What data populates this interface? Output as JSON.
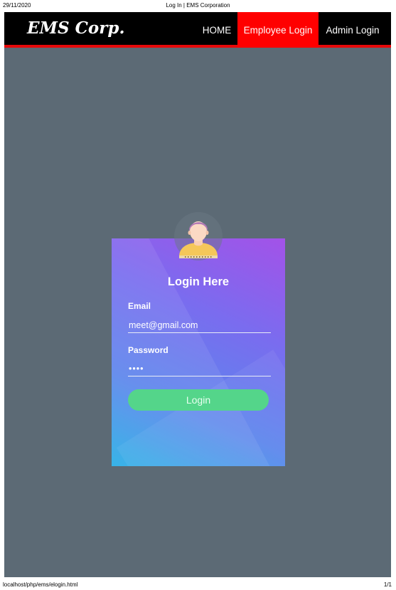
{
  "print_header": {
    "date": "29/11/2020",
    "title": "Log In | EMS Corporation"
  },
  "navbar": {
    "brand": "EMS Corp.",
    "links": [
      {
        "label": "HOME",
        "active": false
      },
      {
        "label": "Employee Login",
        "active": true
      },
      {
        "label": "Admin Login",
        "active": false
      }
    ],
    "colors": {
      "bar": "#000000",
      "accent": "#ff0000",
      "underline": "#e6090a"
    }
  },
  "login_card": {
    "title": "Login Here",
    "email": {
      "label": "Email",
      "value": "meet@gmail.com"
    },
    "password": {
      "label": "Password",
      "value": "••••"
    },
    "submit_label": "Login",
    "avatar_icon": "user-avatar-icon",
    "colors": {
      "gradient_top": "#a352e8",
      "gradient_bottom": "#27aee6",
      "button": "#54d58a"
    }
  },
  "print_footer": {
    "url": "localhost/php/ems/elogin.html",
    "page": "1/1"
  },
  "page_background": "#5c6a75"
}
